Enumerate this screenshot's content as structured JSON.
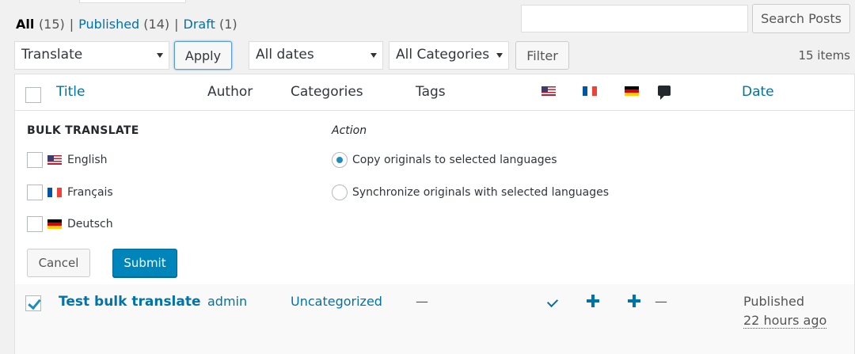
{
  "filters": {
    "all_label": "All",
    "all_count": "(15)",
    "published_label": "Published",
    "published_count": "(14)",
    "draft_label": "Draft",
    "draft_count": "(1)",
    "separator": "|"
  },
  "search": {
    "placeholder": "",
    "button_label": "Search Posts"
  },
  "toolbar": {
    "bulk_action": "Translate",
    "apply_label": "Apply",
    "date_filter": "All dates",
    "category_filter": "All Categories",
    "filter_label": "Filter",
    "items_count": "15 items"
  },
  "columns": {
    "title": "Title",
    "author": "Author",
    "categories": "Categories",
    "tags": "Tags",
    "date": "Date",
    "flag_icons": [
      "flag-us-icon",
      "flag-fr-icon",
      "flag-de-icon"
    ],
    "comments_icon": "comment-bubble-icon"
  },
  "bulk_translate": {
    "heading": "BULK TRANSLATE",
    "action_heading": "Action",
    "languages": [
      {
        "label": "English",
        "flag": "flag-us-icon",
        "checked": false
      },
      {
        "label": "Français",
        "flag": "flag-fr-icon",
        "checked": false
      },
      {
        "label": "Deutsch",
        "flag": "flag-de-icon",
        "checked": false
      }
    ],
    "actions": [
      {
        "label": "Copy originals to selected languages",
        "selected": true
      },
      {
        "label": "Synchronize originals with selected languages",
        "selected": false
      }
    ],
    "cancel_label": "Cancel",
    "submit_label": "Submit"
  },
  "rows": [
    {
      "checked": true,
      "title": "Test bulk translate",
      "author": "admin",
      "category": "Uncategorized",
      "tags": "—",
      "lang_status": [
        "check-icon",
        "plus-icon",
        "plus-icon"
      ],
      "comments": "—",
      "status": "Published",
      "date": "22 hours ago"
    }
  ],
  "colors": {
    "link": "#0073aa",
    "primary_button": "#0085ba",
    "background": "#f1f1f1"
  }
}
